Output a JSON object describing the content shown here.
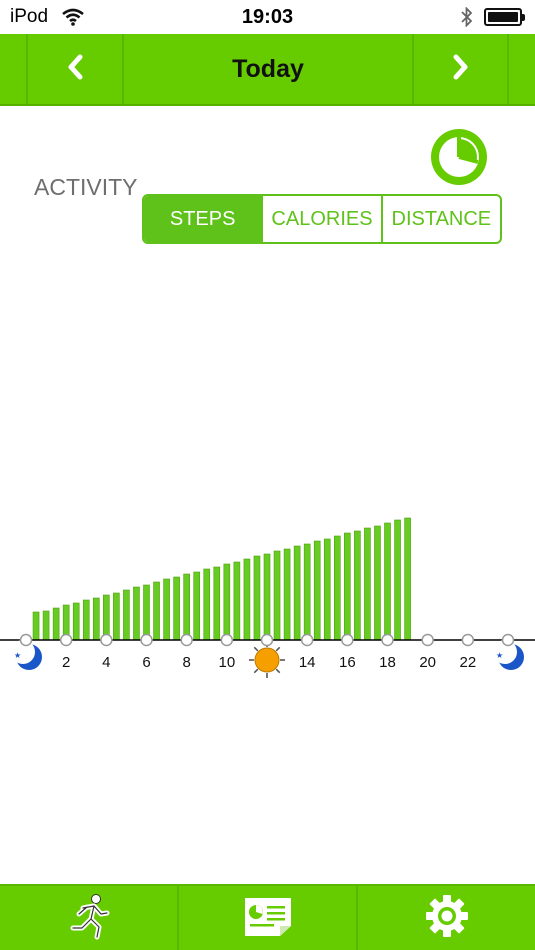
{
  "status_bar": {
    "carrier": "iPod",
    "time": "19:03"
  },
  "nav": {
    "title": "Today",
    "prev_icon": "chevron-left-icon",
    "next_icon": "chevron-right-icon"
  },
  "activity": {
    "label": "ACTIVITY",
    "segments": [
      {
        "label": "STEPS",
        "active": true
      },
      {
        "label": "CALORIES",
        "active": false
      },
      {
        "label": "DISTANCE",
        "active": false
      }
    ],
    "pie_icon": "pie-chart-icon"
  },
  "colors": {
    "accent": "#66cc00",
    "bar": "#66cc22",
    "sun": "#f5a000",
    "moon": "#1a56c8"
  },
  "chart_data": {
    "type": "bar",
    "x_unit": "hour of day",
    "x_range": [
      0,
      24
    ],
    "tick_labels": [
      "2",
      "4",
      "6",
      "8",
      "10",
      "14",
      "16",
      "18",
      "20",
      "22"
    ],
    "tick_values": [
      2,
      4,
      6,
      8,
      10,
      14,
      16,
      18,
      20,
      22
    ],
    "half_hour_bins": [
      0.5,
      1,
      1.5,
      2,
      2.5,
      3,
      3.5,
      4,
      4.5,
      5,
      5.5,
      6,
      6.5,
      7,
      7.5,
      8,
      8.5,
      9,
      9.5,
      10,
      10.5,
      11,
      11.5,
      12,
      12.5,
      13,
      13.5,
      14,
      14.5,
      15,
      15.5,
      16,
      16.5,
      17,
      17.5,
      18,
      18.5,
      19
    ],
    "values": [
      28,
      29,
      32,
      35,
      37,
      40,
      42,
      45,
      47,
      50,
      53,
      55,
      58,
      61,
      63,
      66,
      68,
      71,
      73,
      76,
      78,
      81,
      84,
      86,
      89,
      91,
      94,
      96,
      99,
      101,
      104,
      107,
      109,
      112,
      114,
      117,
      120,
      122
    ],
    "ylim": [
      0,
      140
    ],
    "midday_marker": "sun-icon",
    "night_marker": "moon-icon"
  },
  "tab_bar": {
    "tabs": [
      {
        "icon": "running-person-icon"
      },
      {
        "icon": "report-card-icon"
      },
      {
        "icon": "settings-gear-icon"
      }
    ]
  }
}
